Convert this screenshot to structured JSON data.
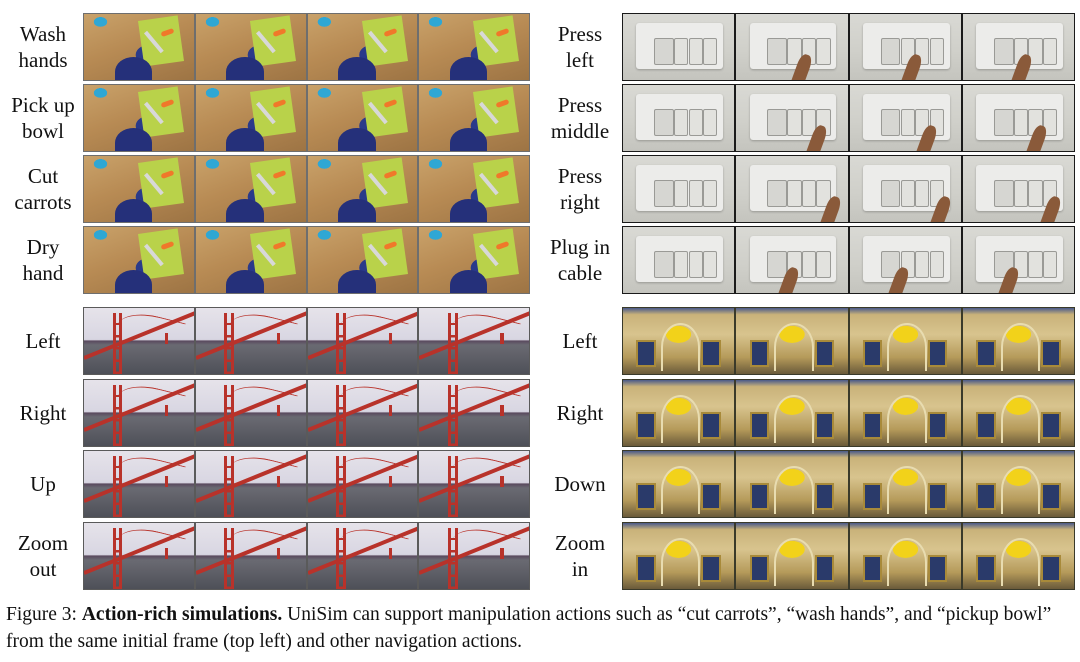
{
  "figure": {
    "number_label": "Figure 3:",
    "title": "Action-rich simulations.",
    "caption_body": " UniSim can support manipulation actions such as “cut carrots”, “wash hands”, and “pickup bowl” from the same initial frame (top left) and other navigation actions."
  },
  "blocks": [
    {
      "id": "kitchen",
      "position": "top-left",
      "scene": "kitchen-countertop-egocentric",
      "frames_per_row": 4,
      "rows": [
        {
          "label": "Wash\nhands"
        },
        {
          "label": "Pick up\nbowl"
        },
        {
          "label": "Cut\ncarrots"
        },
        {
          "label": "Dry\nhand"
        }
      ]
    },
    {
      "id": "outlet",
      "position": "top-right",
      "scene": "wall-switch-panel",
      "frames_per_row": 4,
      "rows": [
        {
          "label": "Press\nleft"
        },
        {
          "label": "Press\nmiddle"
        },
        {
          "label": "Press\nright"
        },
        {
          "label": "Plug in\ncable"
        }
      ]
    },
    {
      "id": "bridge",
      "position": "bottom-left",
      "scene": "golden-gate-bridge",
      "frames_per_row": 4,
      "rows": [
        {
          "label": "Left"
        },
        {
          "label": "Right"
        },
        {
          "label": "Up"
        },
        {
          "label": "Zoom\nout"
        }
      ]
    },
    {
      "id": "chapel",
      "position": "bottom-right",
      "scene": "chapel-interior-dome",
      "frames_per_row": 4,
      "rows": [
        {
          "label": "Left"
        },
        {
          "label": "Right"
        },
        {
          "label": "Down"
        },
        {
          "label": "Zoom\nin"
        }
      ]
    }
  ]
}
